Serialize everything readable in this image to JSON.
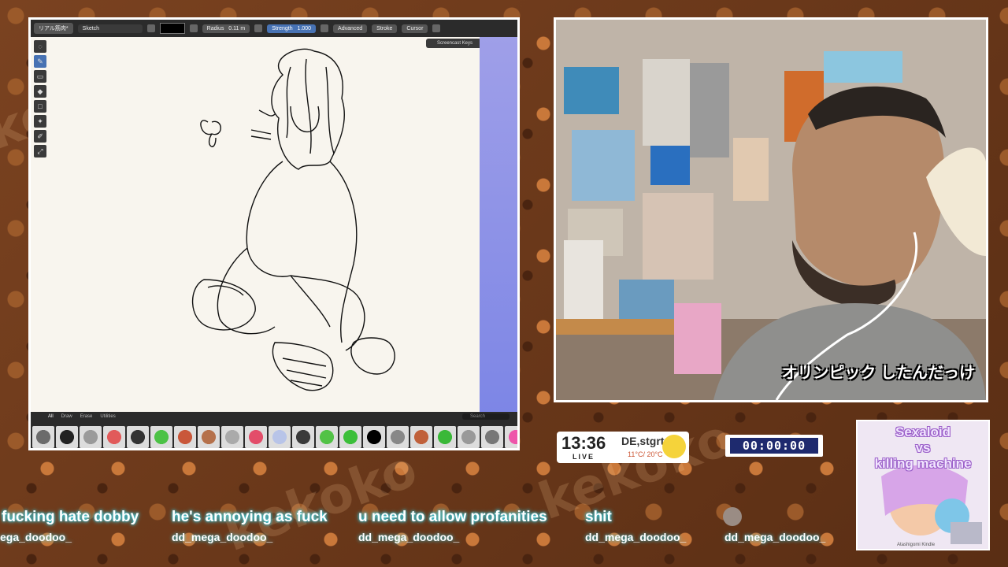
{
  "blender": {
    "layer_name": "リアル筋肉*",
    "material_name": "Sketch",
    "radius_label": "Radius",
    "radius_value": "0.11 m",
    "strength_label": "Strength",
    "strength_value": "1.000",
    "advanced_label": "Advanced",
    "stroke_label": "Stroke",
    "cursor_label": "Cursor",
    "screencast_keys_label": "Screencast Keys",
    "brush_tabs": [
      "All",
      "Draw",
      "Erase",
      "Utilities"
    ],
    "search_placeholder": "Search",
    "brush_colors": [
      "#6b6b6b",
      "#222",
      "#9a9a9a",
      "#e15a5a",
      "#333",
      "#4cc245",
      "#c9573a",
      "#b5714b",
      "#aaa",
      "#e34d6a",
      "#b8c4e8",
      "#3a3a3a",
      "#52c246",
      "#3cbf3a",
      "#000",
      "#888",
      "#c0603a",
      "#3ab838",
      "#999",
      "#777",
      "#ee55aa"
    ]
  },
  "webcam": {
    "subtitle": "オリンピック したんだっけ"
  },
  "clock": {
    "time": "13:36",
    "status": "LIVE",
    "location": "DE,stgrt",
    "temperature": "11°C/ 20°C"
  },
  "timer": {
    "value": "00:00:00"
  },
  "album": {
    "title_line1": "Sexaloid",
    "title_line2": "vs",
    "title_line3": "killing machine",
    "credit": "Atashigomi Kindle"
  },
  "chat": [
    {
      "message": "fucking hate dobby",
      "user": "ega_doodoo_"
    },
    {
      "message": "he's annoying as fuck",
      "user": "dd_mega_doodoo_"
    },
    {
      "message": "u need to allow profanities",
      "user": "dd_mega_doodoo_"
    },
    {
      "message": "shit",
      "user": "dd_mega_doodoo_"
    },
    {
      "message": "",
      "user": "dd_mega_doodoo_"
    }
  ],
  "background_word": "kekoko"
}
